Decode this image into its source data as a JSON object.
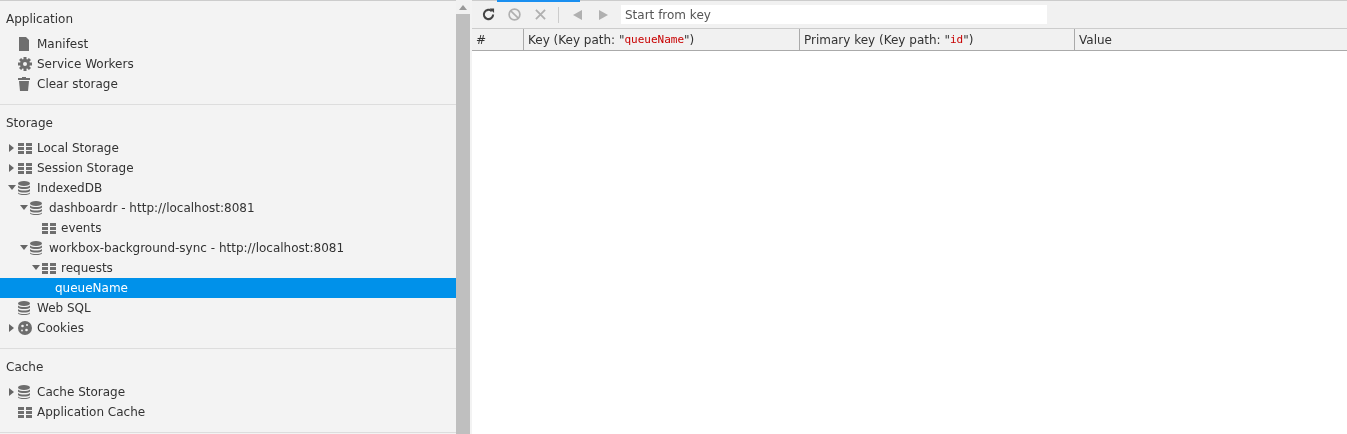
{
  "sidebar": {
    "sections": [
      {
        "title": "Application",
        "items": [
          {
            "label": "Manifest",
            "kind": "file",
            "selected": false
          },
          {
            "label": "Service Workers",
            "kind": "gear",
            "selected": false
          },
          {
            "label": "Clear storage",
            "kind": "trash",
            "selected": false
          }
        ]
      },
      {
        "title": "Storage",
        "items": [
          {
            "label": "Local Storage",
            "kind": "grid",
            "expanded": false,
            "selected": false
          },
          {
            "label": "Session Storage",
            "kind": "grid",
            "expanded": false,
            "selected": false
          },
          {
            "label": "IndexedDB",
            "kind": "database",
            "expanded": true,
            "selected": false,
            "children": [
              {
                "label": "dashboardr - http://localhost:8081",
                "kind": "database",
                "expanded": true,
                "selected": false,
                "children": [
                  {
                    "label": "events",
                    "kind": "grid",
                    "selected": false
                  }
                ]
              },
              {
                "label": "workbox-background-sync - http://localhost:8081",
                "kind": "database",
                "expanded": true,
                "selected": false,
                "children": [
                  {
                    "label": "requests",
                    "kind": "grid",
                    "expanded": true,
                    "selected": false,
                    "children": [
                      {
                        "label": "queueName",
                        "selected": true
                      }
                    ]
                  }
                ]
              }
            ]
          },
          {
            "label": "Web SQL",
            "kind": "database",
            "selected": false
          },
          {
            "label": "Cookies",
            "kind": "cookie",
            "expanded": false,
            "selected": false
          }
        ]
      },
      {
        "title": "Cache",
        "items": [
          {
            "label": "Cache Storage",
            "kind": "database",
            "expanded": false,
            "selected": false
          },
          {
            "label": "Application Cache",
            "kind": "grid",
            "selected": false
          }
        ]
      }
    ]
  },
  "toolbar": {
    "buttons": [
      {
        "kind": "refresh",
        "disabled": false
      },
      {
        "kind": "clear",
        "disabled": true
      },
      {
        "kind": "delete",
        "disabled": true
      },
      {
        "kind": "previous",
        "disabled": true
      },
      {
        "kind": "next",
        "disabled": true
      }
    ],
    "search": {
      "placeholder": "Start from key"
    }
  },
  "table": {
    "columns": [
      {
        "parts": [
          "#"
        ]
      },
      {
        "parts": [
          "Key (Key path: \"",
          "queueName",
          "\")"
        ]
      },
      {
        "parts": [
          "Primary key (Key path: \"",
          "id",
          "\")"
        ]
      },
      {
        "parts": [
          "Value"
        ]
      }
    ]
  }
}
